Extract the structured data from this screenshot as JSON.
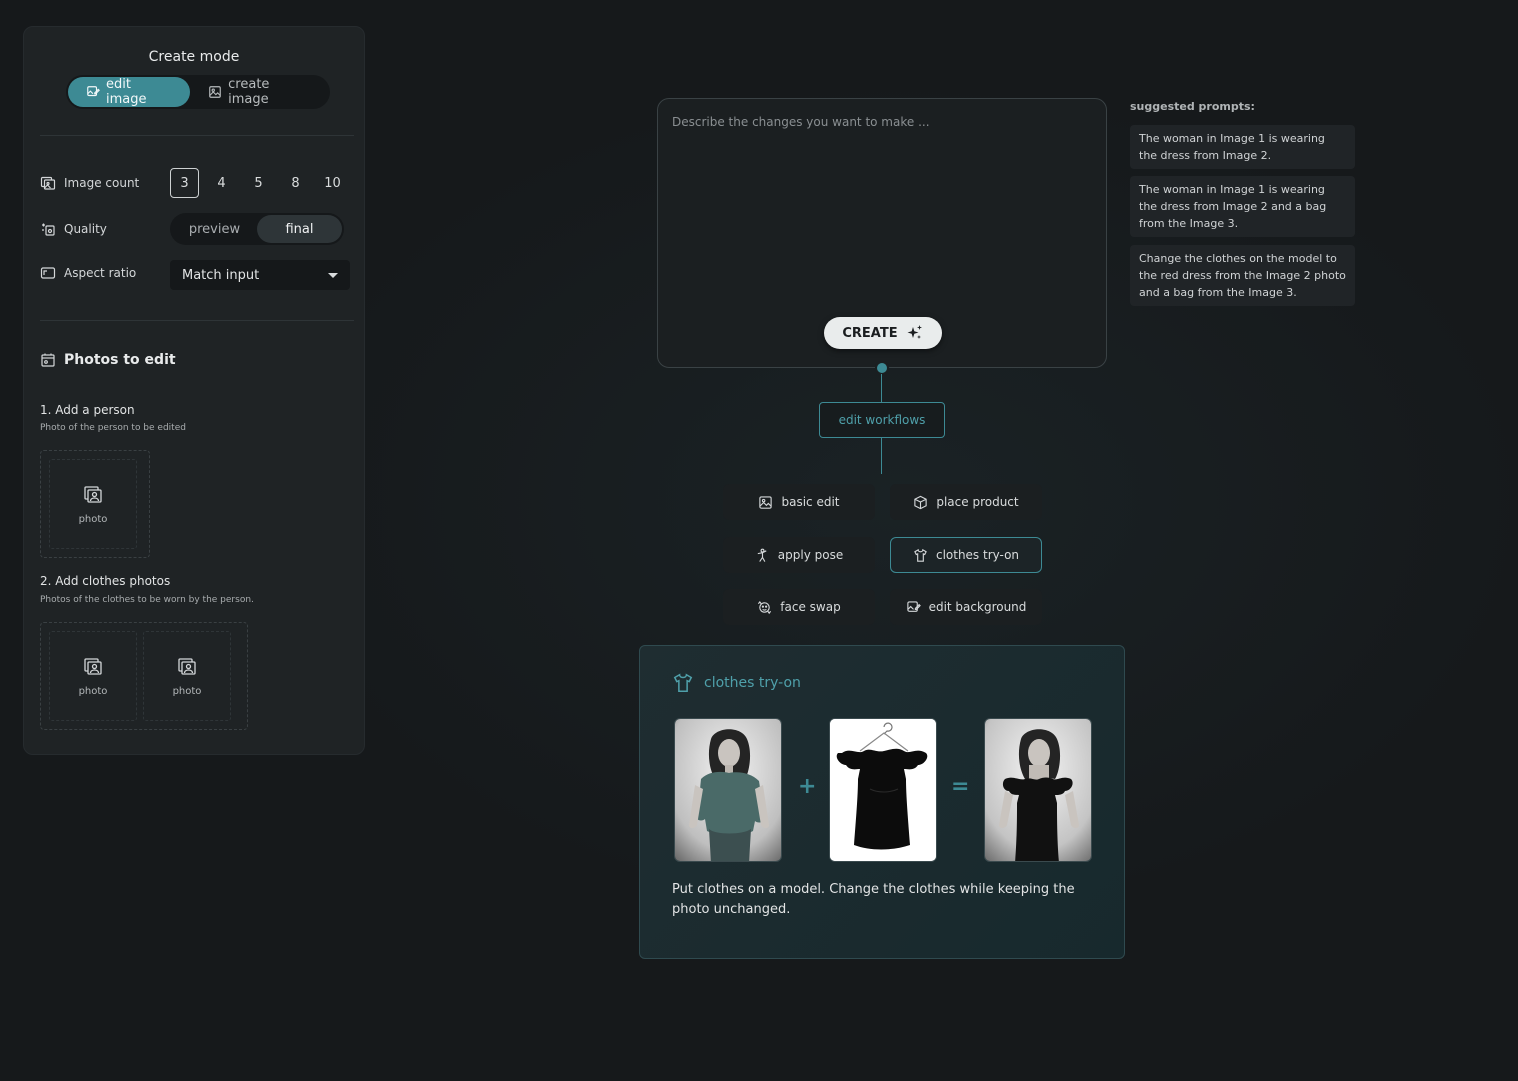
{
  "sidebar": {
    "mode_title": "Create mode",
    "modes": [
      "edit image",
      "create image"
    ],
    "image_count_label": "Image count",
    "image_counts": [
      "3",
      "4",
      "5",
      "8",
      "10"
    ],
    "quality_label": "Quality",
    "quality_options": [
      "preview",
      "final"
    ],
    "aspect_label": "Aspect ratio",
    "aspect_value": "Match input",
    "photos_title": "Photos to edit",
    "step1_title": "1. Add a person",
    "step1_sub": "Photo of the person to be edited",
    "step2_title": "2. Add clothes photos",
    "step2_sub": "Photos of the clothes to be worn by the person.",
    "photo_label": "photo"
  },
  "prompt": {
    "placeholder": "Describe the changes you want to make ...",
    "create_label": "CREATE"
  },
  "workflows": {
    "label": "edit workflows",
    "items": [
      "basic edit",
      "place product",
      "apply pose",
      "clothes try-on",
      "face swap",
      "edit background"
    ]
  },
  "suggestions": {
    "title": "suggested prompts:",
    "items": [
      "The woman in Image 1 is wearing the dress from Image 2.",
      "The woman in Image 1 is wearing the dress from Image 2 and a bag from the Image 3.",
      "Change the clothes on the model to the red dress from the Image 2 photo and a bag from the Image 3."
    ]
  },
  "info": {
    "title": "clothes try-on",
    "plus": "+",
    "equals": "=",
    "description": "Put clothes on a model. Change the clothes while keeping the photo unchanged."
  },
  "colors": {
    "accent": "#3d8a94",
    "background": "#171a1c",
    "panel": "#1f2325"
  }
}
